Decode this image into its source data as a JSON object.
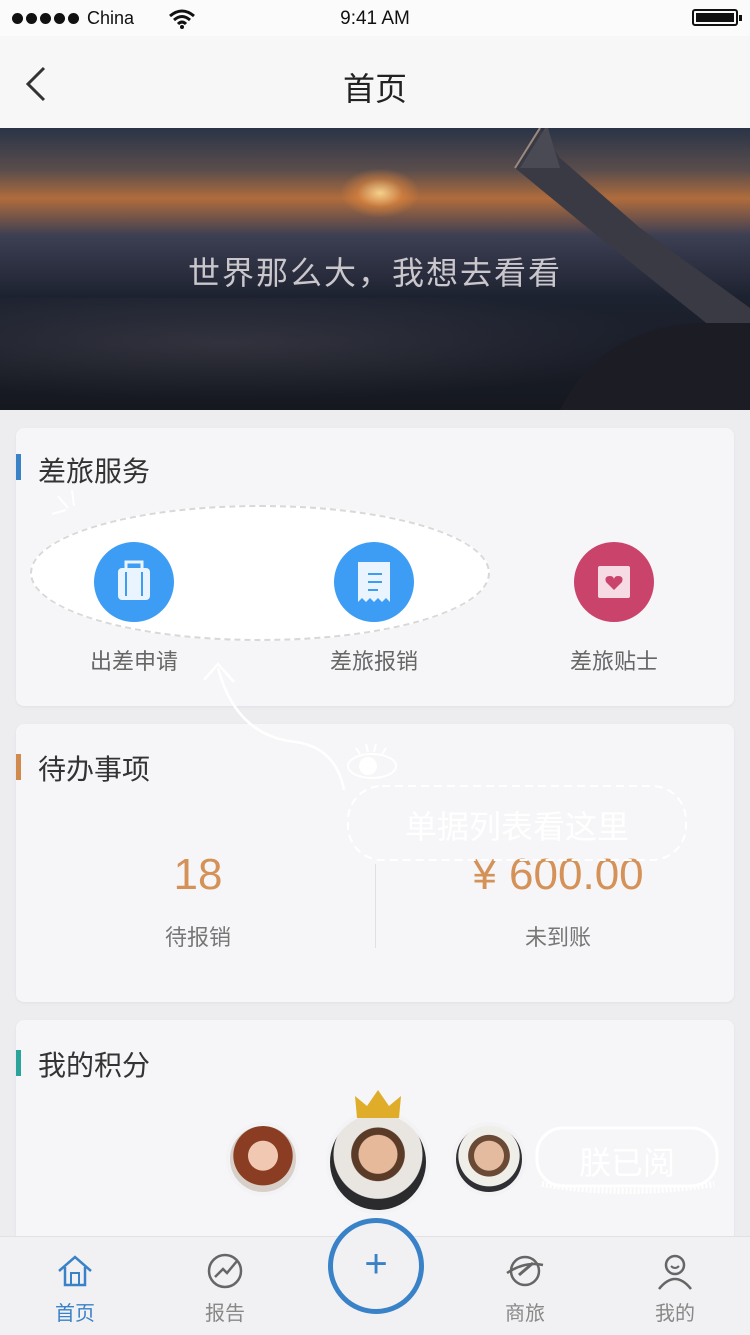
{
  "status_bar": {
    "carrier": "China",
    "time": "9:41 AM"
  },
  "nav": {
    "title": "首页"
  },
  "banner": {
    "slogan": "世界那么大，我想去看看"
  },
  "travel_service": {
    "title": "差旅服务",
    "items": [
      {
        "label": "出差申请",
        "icon": "suitcase-icon",
        "color": "#3d9cf4"
      },
      {
        "label": "差旅报销",
        "icon": "receipt-icon",
        "color": "#3d9cf4"
      },
      {
        "label": "差旅贴士",
        "icon": "heart-note-icon",
        "color": "#c9436b"
      }
    ]
  },
  "todo": {
    "title": "待办事项",
    "stats": [
      {
        "value": "18",
        "label": "待报销"
      },
      {
        "value": "¥ 600.00",
        "label": "未到账"
      }
    ]
  },
  "points": {
    "title": "我的积分"
  },
  "guide": {
    "tip": "单据列表看这里",
    "ack": "朕已阅"
  },
  "tabbar": {
    "items": [
      {
        "label": "首页",
        "icon": "home-icon",
        "active": true
      },
      {
        "label": "报告",
        "icon": "report-icon"
      },
      {
        "label": "",
        "icon": "plus-icon"
      },
      {
        "label": "商旅",
        "icon": "plane-icon"
      },
      {
        "label": "我的",
        "icon": "user-icon"
      }
    ],
    "plus": "+"
  },
  "colors": {
    "accent": "#3a82c8",
    "service_blue": "#3d9cf4",
    "tip_pink": "#c9436b",
    "stat_orange": "#d59258"
  }
}
